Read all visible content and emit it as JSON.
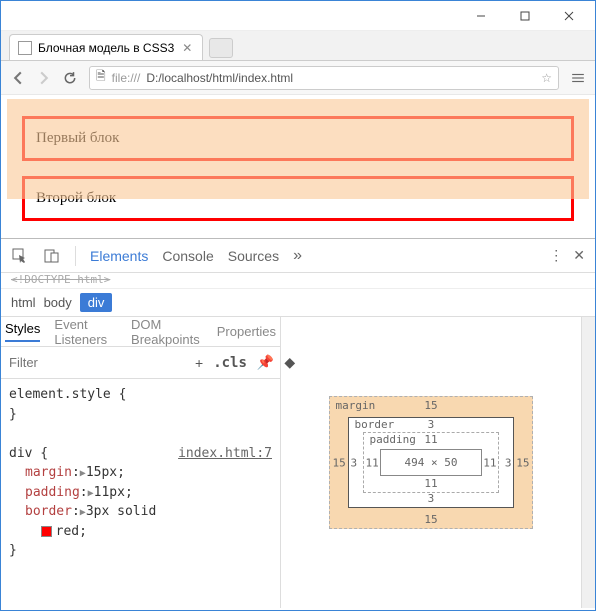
{
  "tab": {
    "title": "Блочная модель в CSS3"
  },
  "url": {
    "scheme": "file:///",
    "path": "D:/localhost/html/index.html"
  },
  "page": {
    "block1": "Первый блок",
    "block2": "Второй блок"
  },
  "devtools": {
    "tabs": {
      "elements": "Elements",
      "console": "Console",
      "sources": "Sources"
    },
    "doctype": "<!DOCTYPE html>",
    "crumbs": {
      "html": "html",
      "body": "body",
      "div": "div"
    },
    "styles_tabs": {
      "styles": "Styles",
      "eventlisteners": "Event Listeners",
      "dombp": "DOM Breakpoints",
      "props": "Properties"
    },
    "filter_placeholder": "Filter",
    "cls": ".cls",
    "rule1": {
      "sel": "element.style {",
      "close": "}"
    },
    "rule2": {
      "sel": "div {",
      "link": "index.html:7",
      "p1n": "margin",
      "p1v": "15px",
      "p2n": "padding",
      "p2v": "11px",
      "p3n": "border",
      "p3v": "3px solid",
      "p3c": "red",
      "close": "}"
    },
    "box": {
      "margin_label": "margin",
      "margin": "15",
      "border_label": "border",
      "border": "3",
      "padding_label": "padding",
      "padding": "11",
      "content": "494 × 50"
    }
  }
}
